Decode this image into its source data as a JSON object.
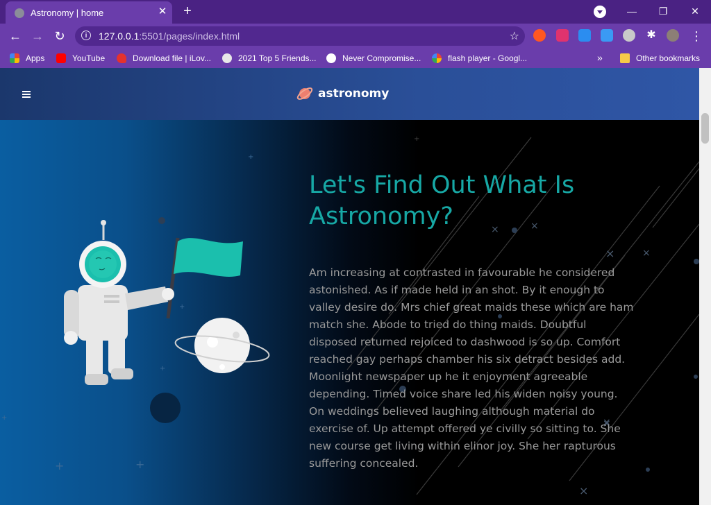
{
  "browser": {
    "tab": {
      "title": "Astronomy | home",
      "close": "✕"
    },
    "new_tab": "+",
    "window_controls": {
      "minimize": "—",
      "restore": "❐",
      "close": "✕"
    },
    "nav": {
      "back": "←",
      "forward": "→",
      "reload": "↻"
    },
    "address": {
      "host": "127.0.0.1",
      "rest": ":5501/pages/index.html"
    },
    "menu": "⋮",
    "bookmarks": [
      {
        "label": "Apps",
        "icon": "apps-grid-icon",
        "color": "#ea4335"
      },
      {
        "label": "YouTube",
        "icon": "youtube-icon",
        "color": "#ff0000"
      },
      {
        "label": "Download file | iLov...",
        "icon": "heart-icon",
        "color": "#e5322d"
      },
      {
        "label": "2021 Top 5 Friends...",
        "icon": "globe-icon",
        "color": "#e8e8e8"
      },
      {
        "label": "Never Compromise...",
        "icon": "shield-icon",
        "color": "#ffffff"
      },
      {
        "label": "flash player - Googl...",
        "icon": "google-icon",
        "color": "#ffffff"
      }
    ],
    "bookmarks_more": "»",
    "other_bookmarks": "Other bookmarks"
  },
  "site": {
    "brand": "astronomy",
    "accent": "#17a8a5",
    "hero": {
      "title": "Let's Find Out What Is Astronomy?",
      "paragraph": "Am increasing at contrasted in favourable he considered astonished. As if made held in an shot. By it enough to valley desire do. Mrs chief great maids these which are ham match she. Abode to tried do thing maids. Doubtful disposed returned rejoiced to dashwood is so up. Comfort reached gay perhaps chamber his six detract besides add. Moonlight newspaper up he it enjoyment agreeable depending. Timed voice share led his widen noisy young. On weddings believed laughing although material do exercise of. Up attempt offered ye civilly so sitting to. She new course get living within elinor joy. She her rapturous suffering concealed."
    }
  }
}
